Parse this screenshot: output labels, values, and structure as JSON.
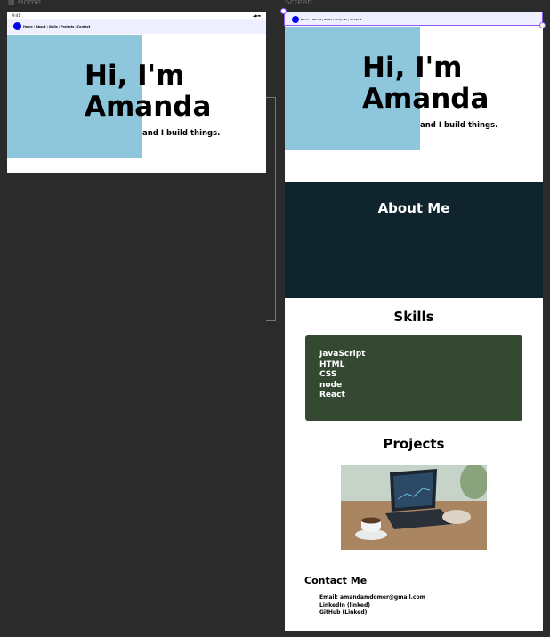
{
  "canvas": {
    "home_frame_label": "Home",
    "screen_frame_label": "Screen",
    "home_frame_icon": "frame-icon",
    "screen_frame_icon": "frame-icon"
  },
  "statusbar": {
    "time": "9:41",
    "icons": "▴◆▬"
  },
  "nav": {
    "logo_color": "#0000ee",
    "home_links": "Home | About | Skills | Projects | Contact",
    "screen_links": "Home | About | Skills | Projects | Contact"
  },
  "hero": {
    "title_line1": "Hi, I'm",
    "title_line2": "Amanda",
    "subtitle": "and I build things.",
    "block_color": "#8ec6dc"
  },
  "about": {
    "title": "About Me",
    "bg_color": "#10242d"
  },
  "skills": {
    "title": "Skills",
    "items": [
      "JavaScript",
      "HTML",
      "CSS",
      "node",
      "React"
    ],
    "box_color": "#354932"
  },
  "projects": {
    "title": "Projects",
    "image": "laptop-coffee-photo"
  },
  "contact": {
    "title": "Contact Me",
    "email": "Email: amandamdomer@gmail.com",
    "linkedin": "LinkedIn (linked)",
    "github": "GitHub (Linked)"
  },
  "colors": {
    "canvas_bg": "#2b2b2b",
    "selection": "#8a5cf5"
  }
}
